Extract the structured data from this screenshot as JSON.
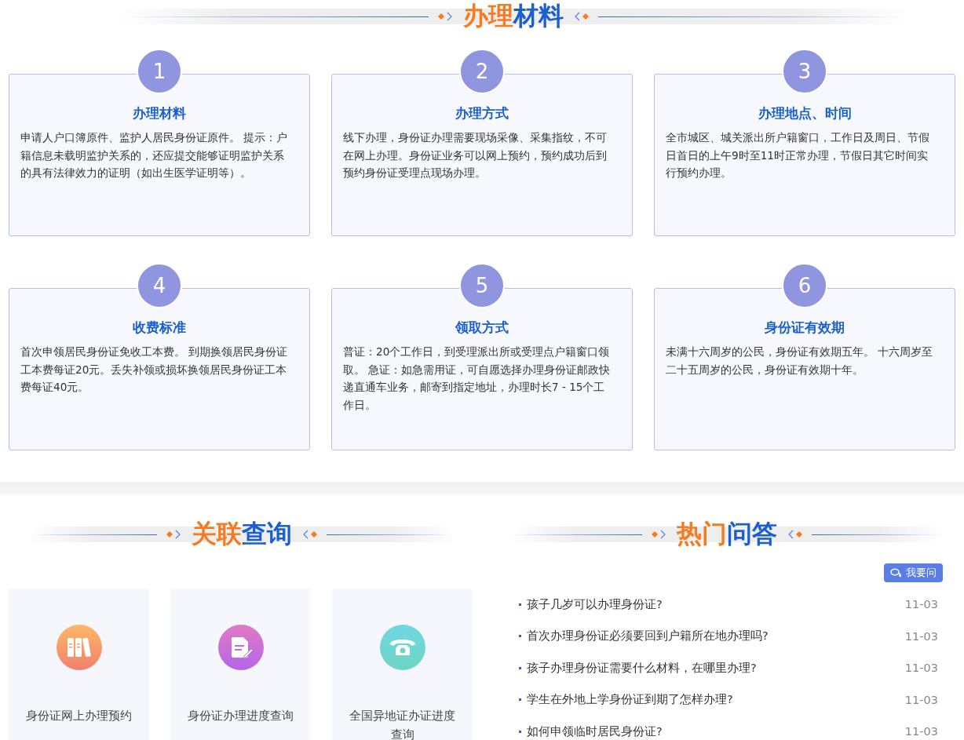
{
  "materials_heading": {
    "accent": "办理",
    "main": "材料"
  },
  "cards": [
    {
      "number": "1",
      "title": "办理材料",
      "text": "申请人户口簿原件、监护人居民身份证原件。 提示：户籍信息未载明监护关系的，还应提交能够证明监护关系的具有法律效力的证明（如出生医学证明等）。"
    },
    {
      "number": "2",
      "title": "办理方式",
      "text": "线下办理，身份证办理需要现场采像、采集指纹，不可在网上办理。身份证业务可以网上预约，预约成功后到预约身份证受理点现场办理。"
    },
    {
      "number": "3",
      "title": "办理地点、时间",
      "text": "全市城区、城关派出所户籍窗口，工作日及周日、节假日首日的上午9时至11时正常办理，节假日其它时间实行预约办理。"
    },
    {
      "number": "4",
      "title": "收费标准",
      "text": "首次申领居民身份证免收工本费。 到期换领居民身份证工本费每证20元。丢失补领或损坏换领居民身份证工本费每证40元。"
    },
    {
      "number": "5",
      "title": "领取方式",
      "text": "普证：20个工作日，到受理派出所或受理点户籍窗口领取。 急证：如急需用证，可自愿选择办理身份证邮政快递直通车业务，邮寄到指定地址，办理时长7 - 15个工作日。"
    },
    {
      "number": "6",
      "title": "身份证有效期",
      "text": "未满十六周岁的公民，身份证有效期五年。 十六周岁至二十五周岁的公民，身份证有效期十年。"
    }
  ],
  "related": {
    "heading": {
      "accent": "关联",
      "main": "查询"
    },
    "links": [
      {
        "kind": "books",
        "label": "身份证网上办理预约"
      },
      {
        "kind": "document",
        "label": "身份证办理进度查询"
      },
      {
        "kind": "phone",
        "label": "全国异地证办证进度查询"
      }
    ]
  },
  "faq": {
    "heading": {
      "accent": "热门",
      "main": "问答"
    },
    "ask_button": "我要问",
    "questions": [
      {
        "text": "孩子几岁可以办理身份证?",
        "date": "11-03"
      },
      {
        "text": "首次办理身份证必须要回到户籍所在地办理吗?",
        "date": "11-03"
      },
      {
        "text": "孩子办理身份证需要什么材料，在哪里办理?",
        "date": "11-03"
      },
      {
        "text": "学生在外地上学身份证到期了怎样办理?",
        "date": "11-03"
      },
      {
        "text": "如何申领临时居民身份证?",
        "date": "11-03"
      }
    ]
  }
}
